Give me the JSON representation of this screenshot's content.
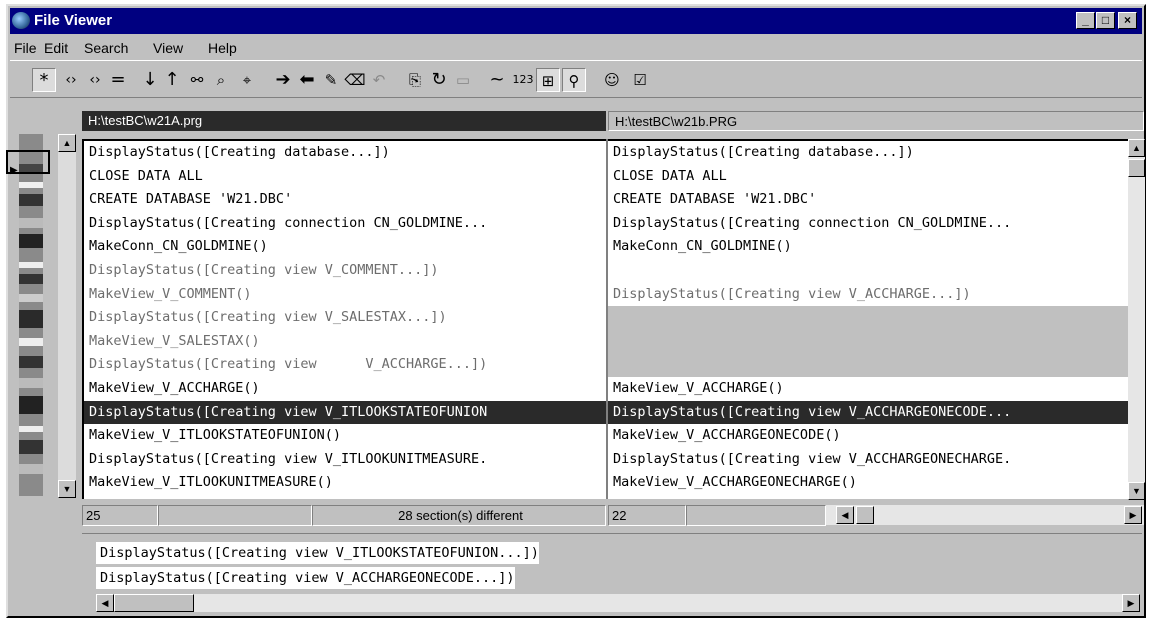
{
  "window": {
    "title": "File Viewer",
    "buttons": {
      "minimize": "_",
      "maximize": "□",
      "close": "×"
    }
  },
  "menu": [
    "File",
    "Edit",
    "Search",
    "View",
    "Help"
  ],
  "toolbar": {
    "icons": [
      "asterisk-icon",
      "prev-diff-icon",
      "next-diff-icon",
      "equal-icon",
      "down-arrow-icon",
      "up-arrow-icon",
      "binoculars-icon",
      "find-icon",
      "find-next-icon",
      "copy-right-icon",
      "copy-left-icon",
      "edit-icon",
      "erase-icon",
      "undo-icon",
      "compare-icon",
      "refresh-icon",
      "save-icon",
      "tilde-icon",
      "number-icon",
      "layout-icon",
      "search-icon",
      "user-icon",
      "checklist-icon"
    ],
    "number_label": "123",
    "tilde_label": "~"
  },
  "paths": {
    "left": "H:\\testBC\\w21A.prg",
    "right": "H:\\testBC\\w21b.PRG"
  },
  "left_lines": [
    {
      "text": "DisplayStatus([Creating database...])",
      "state": "same"
    },
    {
      "text": "CLOSE DATA ALL",
      "state": "same"
    },
    {
      "text": "CREATE DATABASE 'W21.DBC'",
      "state": "same"
    },
    {
      "text": "DisplayStatus([Creating connection CN_GOLDMINE...",
      "state": "same"
    },
    {
      "text": "MakeConn_CN_GOLDMINE()",
      "state": "same"
    },
    {
      "text": "DisplayStatus([Creating view V_COMMENT...])",
      "state": "diff"
    },
    {
      "text": "MakeView_V_COMMENT()",
      "state": "diff"
    },
    {
      "text": "DisplayStatus([Creating view V_SALESTAX...])",
      "state": "diff"
    },
    {
      "text": "MakeView_V_SALESTAX()",
      "state": "diff"
    },
    {
      "text": "DisplayStatus([Creating view      V_ACCHARGE...])",
      "state": "diff"
    },
    {
      "text": "MakeView_V_ACCHARGE()",
      "state": "same"
    },
    {
      "text": "DisplayStatus([Creating view V_ITLOOKSTATEOFUNION",
      "state": "sel"
    },
    {
      "text": "MakeView_V_ITLOOKSTATEOFUNION()",
      "state": "same"
    },
    {
      "text": "DisplayStatus([Creating view V_ITLOOKUNITMEASURE.",
      "state": "same"
    },
    {
      "text": "MakeView_V_ITLOOKUNITMEASURE()",
      "state": "same"
    }
  ],
  "right_lines": [
    {
      "text": "DisplayStatus([Creating database...])",
      "state": "same"
    },
    {
      "text": "CLOSE DATA ALL",
      "state": "same"
    },
    {
      "text": "CREATE DATABASE 'W21.DBC'",
      "state": "same"
    },
    {
      "text": "DisplayStatus([Creating connection CN_GOLDMINE...",
      "state": "same"
    },
    {
      "text": "MakeConn_CN_GOLDMINE()",
      "state": "same"
    },
    {
      "text": "",
      "state": "blank"
    },
    {
      "text": "DisplayStatus([Creating view V_ACCHARGE...])",
      "state": "diff"
    },
    {
      "text": "",
      "state": "gap"
    },
    {
      "text": "",
      "state": "gap"
    },
    {
      "text": "",
      "state": "gap"
    },
    {
      "text": "MakeView_V_ACCHARGE()",
      "state": "same"
    },
    {
      "text": "DisplayStatus([Creating view V_ACCHARGEONECODE...",
      "state": "sel"
    },
    {
      "text": "MakeView_V_ACCHARGEONECODE()",
      "state": "same"
    },
    {
      "text": "DisplayStatus([Creating view V_ACCHARGEONECHARGE.",
      "state": "same"
    },
    {
      "text": "MakeView_V_ACCHARGEONECHARGE()",
      "state": "same"
    }
  ],
  "status": {
    "left_line": "25",
    "sections": "28 section(s) different",
    "right_line": "22"
  },
  "detail": {
    "left": "DisplayStatus([Creating view V_ITLOOKSTATEOFUNION...])",
    "right": "DisplayStatus([Creating view V_ACCHARGEONECODE...])"
  },
  "colors": {
    "title_bg": "#000080",
    "selection_bg": "#2a2a2a",
    "gap_bg": "#c0c0c0",
    "diff_text": "#6d6d6d"
  }
}
